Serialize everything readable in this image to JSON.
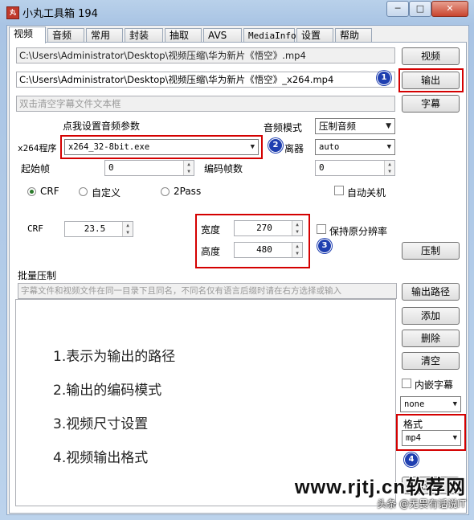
{
  "window": {
    "app_icon_text": "丸",
    "title": "小丸工具箱 194",
    "buttons": {
      "minimize": "─",
      "maximize": "□",
      "close": "✕"
    }
  },
  "tabs": [
    "视频",
    "音频",
    "常用",
    "封装",
    "抽取",
    "AVS",
    "MediaInfo",
    "设置",
    "帮助"
  ],
  "files": {
    "video_path": "C:\\Users\\Administrator\\Desktop\\视频压缩\\华为新片《悟空》.mp4",
    "output_path": "C:\\Users\\Administrator\\Desktop\\视频压缩\\华为新片《悟空》_x264.mp4",
    "subtitle_hint": "双击清空字幕文件文本框",
    "video_button": "视频",
    "output_button": "输出",
    "subtitle_button": "字幕"
  },
  "encoder": {
    "audio_params_link": "点我设置音频参数",
    "x264_label": "x264程序",
    "x264_value": "x264_32-8bit.exe",
    "audio_mode_label": "音频模式",
    "audio_mode_value": "压制音频",
    "demuxer_label": "离器",
    "demuxer_value": "auto",
    "start_frame_label": "起始帧",
    "start_frame_value": "0",
    "encode_frames_label": "编码帧数",
    "encode_frames_value": "0",
    "extra_value": "0",
    "rate_modes": [
      "CRF",
      "自定义",
      "2Pass"
    ],
    "rate_mode_selected": "CRF",
    "auto_shutdown_label": "自动关机",
    "crf_label": "CRF",
    "crf_value": "23.5",
    "width_label": "宽度",
    "width_value": "270",
    "height_label": "高度",
    "height_value": "480",
    "keep_resolution_label": "保持原分辨率",
    "compress_button": "压制"
  },
  "batch": {
    "label": "批量压制",
    "hint": "字幕文件和视频文件在同一目录下且同名，不同名仅有语言后缀时请在右方选择或输入",
    "output_path_button": "输出路径",
    "add_button": "添加",
    "delete_button": "删除",
    "clear_button": "清空",
    "embed_subtitle_label": "内嵌字幕",
    "subtitle_lang_value": "none",
    "format_label": "格式",
    "format_value": "mp4",
    "hidden_button_text": "压制"
  },
  "annotations": {
    "badges": [
      "1",
      "2",
      "3",
      "4"
    ],
    "notes": [
      "1.表示为输出的路径",
      "2.输出的编码模式",
      "3.视频尺寸设置",
      "4.视频输出格式"
    ],
    "highlight_color": "#d40000",
    "badge_color": "#1f3fb0"
  },
  "watermark": {
    "site": "www.rjtj.cn软荐网",
    "credit": "头条 @无畏有话说IT"
  }
}
